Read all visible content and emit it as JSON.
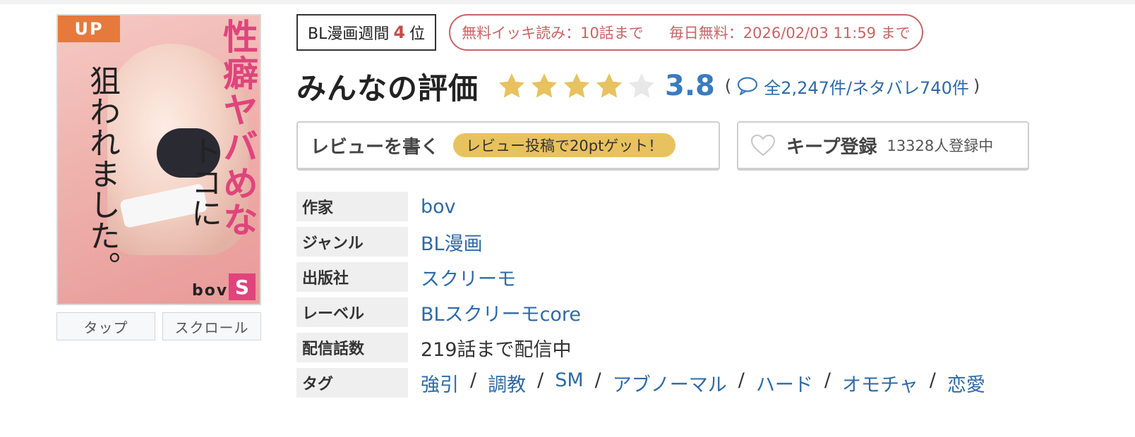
{
  "cover": {
    "badge": "UP",
    "title_line1": "性癖ヤバめな",
    "title_line2": "トコに",
    "title_line3": "狙われました。",
    "author_mark": "bov",
    "publisher_logo": "S",
    "tap_label": "タップ",
    "scroll_label": "スクロール"
  },
  "ranking": {
    "prefix": "BL漫画週間",
    "rank": "4",
    "suffix": "位"
  },
  "free": {
    "ikki": "無料イッキ読み：10話まで",
    "daily": "毎日無料：2026/02/03 11:59 まで"
  },
  "rating": {
    "title": "みんなの評価",
    "score": "3.8",
    "stars_value": 3.8,
    "star_color": "#e8c25e",
    "star_empty_color": "#e8e8e8",
    "open_paren": "(",
    "close_paren": ")",
    "reviews_text": "全2,247件/ネタバレ740件"
  },
  "actions": {
    "review_label": "レビューを書く",
    "review_bonus": "レビュー投稿で20ptゲット！",
    "keep_label": "キープ登録",
    "keep_count": "13328人登録中"
  },
  "info": {
    "author_key": "作家",
    "author_val": "bov",
    "genre_key": "ジャンル",
    "genre_val": "BL漫画",
    "publisher_key": "出版社",
    "publisher_val": "スクリーモ",
    "label_key": "レーベル",
    "label_val": "BLスクリーモcore",
    "episodes_key": "配信話数",
    "episodes_val": "219話まで配信中",
    "tags_key": "タグ",
    "separator": "/",
    "tags": [
      "強引",
      "調教",
      "SM",
      "アブノーマル",
      "ハード",
      "オモチャ",
      "恋愛"
    ]
  },
  "icons": {
    "review_count": "speech-bubble-icon",
    "keep": "heart-icon"
  }
}
